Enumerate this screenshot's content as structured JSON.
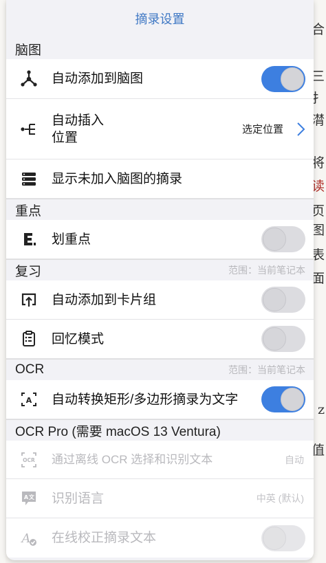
{
  "background": {
    "right_chars": [
      {
        "text": "合",
        "red": false
      },
      {
        "text": "三",
        "red": false
      },
      {
        "text": "扌",
        "red": false
      },
      {
        "text": "潸",
        "red": false
      },
      {
        "text": "将",
        "red": false
      },
      {
        "text": "读",
        "red": true
      },
      {
        "text": "页",
        "red": false
      },
      {
        "text": "图",
        "red": false
      },
      {
        "text": "表",
        "red": false
      },
      {
        "text": "面",
        "red": false
      },
      {
        "text": "z",
        "red": false
      },
      {
        "text": "值",
        "red": false
      }
    ]
  },
  "panel": {
    "title": "摘录设置",
    "sections": {
      "mindmap": {
        "header": "脑图",
        "auto_add": {
          "label": "自动添加到脑图",
          "on": true
        },
        "auto_insert": {
          "label": "自动插入\n位置",
          "value": "选定位置"
        },
        "show_unadded": {
          "label": "显示未加入脑图的摘录"
        }
      },
      "highlight": {
        "header": "重点",
        "mark": {
          "label": "划重点",
          "on": false
        }
      },
      "review": {
        "header": "复习",
        "note": "范围：当前笔记本",
        "auto_add_cards": {
          "label": "自动添加到卡片组",
          "on": false
        },
        "recall_mode": {
          "label": "回忆模式",
          "on": false
        }
      },
      "ocr": {
        "header": "OCR",
        "note": "范围：当前笔记本",
        "convert": {
          "label": "自动转换矩形/多边形摘录为文字",
          "on": true
        }
      },
      "ocr_pro": {
        "header": "OCR Pro (需要 macOS 13 Ventura)",
        "offline": {
          "label": "通过离线 OCR 选择和识别文本",
          "value": "自动"
        },
        "language": {
          "label": "识别语言",
          "value": "中英 (默认)"
        },
        "online_fix": {
          "label": "在线校正摘录文本",
          "on": false
        }
      }
    }
  },
  "colors": {
    "accent": "#3d7fe0",
    "title": "#3f78c4"
  },
  "icons": [
    "mindmap-node-icon",
    "insert-position-icon",
    "stack-list-icon",
    "highlight-e-icon",
    "card-upload-icon",
    "clipboard-recall-icon",
    "ocr-text-scan-icon",
    "ocr-chip-icon",
    "translate-icon",
    "text-check-icon",
    "chevron-right-icon"
  ]
}
